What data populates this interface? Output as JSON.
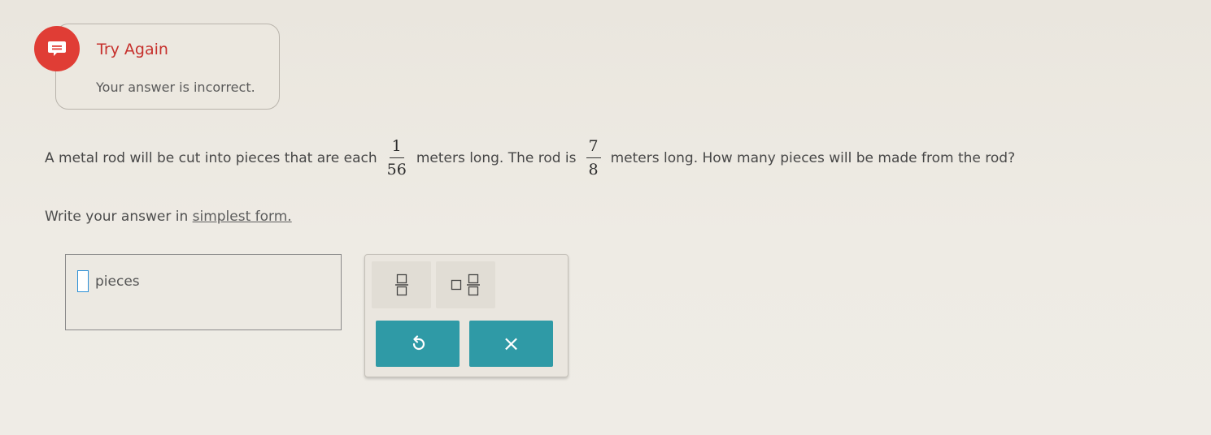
{
  "feedback": {
    "title": "Try Again",
    "message": "Your answer is incorrect.",
    "icon": "feedback-chat-icon",
    "accent_color": "#e03d35"
  },
  "question": {
    "text_before": "A metal rod will be cut into pieces that are each",
    "fraction1": {
      "numerator": "1",
      "denominator": "56"
    },
    "text_middle": "meters long. The rod is",
    "fraction2": {
      "numerator": "7",
      "denominator": "8"
    },
    "text_after": "meters long. How many pieces will be made from the rod?"
  },
  "instruction": {
    "prefix": "Write your answer in",
    "link": "simplest form."
  },
  "answer": {
    "value": "",
    "unit": "pieces"
  },
  "keypad": {
    "fraction_key_icon": "fraction-template-icon",
    "mixed_number_key_icon": "mixed-number-template-icon",
    "undo_key_icon": "undo-icon",
    "clear_key_icon": "clear-x-icon",
    "clear_label": "×",
    "button_color": "#2f9aa6"
  }
}
